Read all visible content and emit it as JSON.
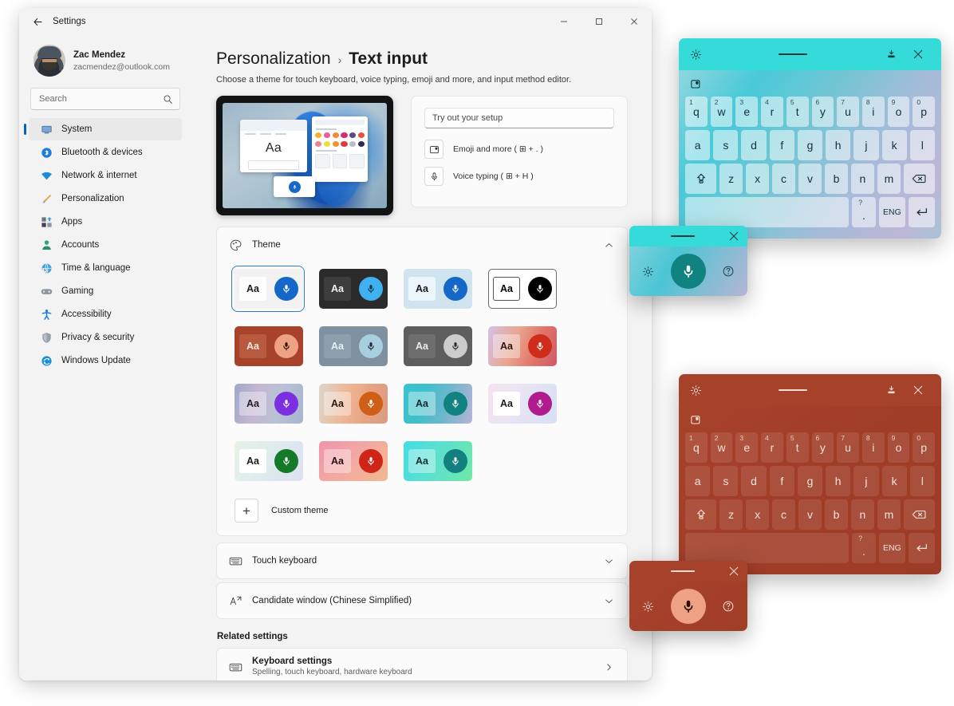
{
  "window": {
    "title": "Settings",
    "back_icon": "back-arrow-icon",
    "minimize": "−",
    "maximize": "▢",
    "close": "✕"
  },
  "account": {
    "name": "Zac Mendez",
    "email": "zacmendez@outlook.com",
    "avatar_icon": "user-avatar-photo"
  },
  "search": {
    "placeholder": "Search",
    "icon": "search-icon"
  },
  "sidebar": {
    "items": [
      {
        "label": "System",
        "icon": "monitor-icon",
        "active": true
      },
      {
        "label": "Bluetooth & devices",
        "icon": "bluetooth-icon",
        "active": false
      },
      {
        "label": "Network & internet",
        "icon": "wifi-icon",
        "active": false
      },
      {
        "label": "Personalization",
        "icon": "paintbrush-icon",
        "active": false
      },
      {
        "label": "Apps",
        "icon": "apps-icon",
        "active": false
      },
      {
        "label": "Accounts",
        "icon": "account-icon",
        "active": false
      },
      {
        "label": "Time & language",
        "icon": "clock-globe-icon",
        "active": false
      },
      {
        "label": "Gaming",
        "icon": "gamepad-icon",
        "active": false
      },
      {
        "label": "Accessibility",
        "icon": "accessibility-icon",
        "active": false
      },
      {
        "label": "Privacy & security",
        "icon": "shield-icon",
        "active": false
      },
      {
        "label": "Windows Update",
        "icon": "update-icon",
        "active": false
      }
    ]
  },
  "page": {
    "breadcrumb_parent": "Personalization",
    "breadcrumb_sep": "›",
    "breadcrumb_current": "Text input",
    "subtitle": "Choose a theme for touch keyboard, voice typing, emoji and more, and input method editor."
  },
  "tryout": {
    "input_placeholder": "Try out your setup",
    "rows": [
      {
        "label": "Emoji and more ( ⊞ + . )",
        "icon": "emoji-picker-icon"
      },
      {
        "label": "Voice typing ( ⊞ + H )",
        "icon": "microphone-icon"
      }
    ]
  },
  "theme_section": {
    "title": "Theme",
    "icon": "palette-icon",
    "chevron": "chevron-up-icon",
    "custom_theme_label": "Custom theme",
    "custom_theme_plus": "+",
    "swatches": [
      {
        "name": "light-default",
        "selected": true,
        "bg": "#f2f2f2",
        "box": "#fdfdfd",
        "aa": "#1b1b1b",
        "mic": "#1668c8",
        "mic_glyph": "#ffffff",
        "gradient": ""
      },
      {
        "name": "dark",
        "selected": false,
        "bg": "#2b2b2b",
        "box": "#3d3d3d",
        "aa": "#f0f0f0",
        "mic": "#3fb0f0",
        "mic_glyph": "#16364d",
        "gradient": ""
      },
      {
        "name": "powder-blue",
        "selected": false,
        "bg": "#cfe4ef",
        "box": "#ecf5fa",
        "aa": "#1b1b1b",
        "mic": "#1668c8",
        "mic_glyph": "#ffffff",
        "gradient": ""
      },
      {
        "name": "high-contrast-white",
        "selected": false,
        "bg": "#ffffff",
        "box": "#ffffff",
        "aa": "#000000",
        "mic": "#000000",
        "mic_glyph": "#ffffff",
        "gradient": ""
      },
      {
        "name": "brick-red",
        "selected": false,
        "bg": "#a8422a",
        "box": "#b85a40",
        "aa": "#f6e6e0",
        "mic": "#efa184",
        "mic_glyph": "#2b1008",
        "gradient": ""
      },
      {
        "name": "slate-blue",
        "selected": false,
        "bg": "#7e91a0",
        "box": "#8c9fad",
        "aa": "#e9eef2",
        "mic": "#a8cfe0",
        "mic_glyph": "#1b2a33",
        "gradient": ""
      },
      {
        "name": "graphite-gray",
        "selected": false,
        "bg": "#5e5e5e",
        "box": "#6e6e6e",
        "aa": "#ececec",
        "mic": "#cccccc",
        "mic_glyph": "#2b2b2b",
        "gradient": ""
      },
      {
        "name": "sunset-red",
        "selected": false,
        "bg": "#e2a08f",
        "box": "#f0c6b8",
        "aa": "#2a1410",
        "mic": "#cf2d1c",
        "mic_glyph": "#ffffff",
        "gradient": "linear-gradient(110deg,#d3c2e8 0%,#e9a58f 38%,#e2756a 68%,#cf5a6a 100%)"
      },
      {
        "name": "lavender-mist",
        "selected": false,
        "bg": "#b9aecb",
        "box": "#cfc7dd",
        "aa": "#24202b",
        "mic": "#7b2fe0",
        "mic_glyph": "#ffffff",
        "gradient": "linear-gradient(105deg,#9fa8c9 0%,#c4b6d2 32%,#b9c2d6 62%,#a8b4cf 100%)"
      },
      {
        "name": "peach-sand",
        "selected": false,
        "bg": "#e6b99a",
        "box": "#f2d7c4",
        "aa": "#2a1a10",
        "mic": "#cf5e16",
        "mic_glyph": "#ffffff",
        "gradient": "linear-gradient(100deg,#dcd6cc 0%,#efb594 40%,#e8a381 70%,#d99a85 100%)"
      },
      {
        "name": "teal-wave",
        "selected": false,
        "bg": "#3fc6d0",
        "box": "#7fd8e0",
        "aa": "#102a2e",
        "mic": "#10827f",
        "mic_glyph": "#ffffff",
        "gradient": "linear-gradient(105deg,#38c4cf 0%,#3ec0cb 30%,#6fb6cc 62%,#b6b4d8 100%)"
      },
      {
        "name": "orchid-white",
        "selected": false,
        "bg": "#dbe3f4",
        "box": "#ffffff",
        "aa": "#1b1b1b",
        "mic": "#b01b8e",
        "mic_glyph": "#ffffff",
        "gradient": "linear-gradient(110deg,#f4e4f0 0%,#e6e4f4 50%,#d6e0f6 100%)"
      },
      {
        "name": "mint-green",
        "selected": false,
        "bg": "#dff0e4",
        "box": "#ffffff",
        "aa": "#1b1b1b",
        "mic": "#137a28",
        "mic_glyph": "#ffffff",
        "gradient": "linear-gradient(115deg,#e4f4e6 0%,#dfeced 45%,#dde0f2 100%)"
      },
      {
        "name": "coral-pink",
        "selected": false,
        "bg": "#f09ca8",
        "box": "#f7c2bc",
        "aa": "#2a1012",
        "mic": "#cf2418",
        "mic_glyph": "#ffffff",
        "gradient": "linear-gradient(135deg,#ef93ad 0%,#f3a9a2 50%,#f2b98c 100%)"
      },
      {
        "name": "aqua-mint",
        "selected": false,
        "bg": "#5fe0c8",
        "box": "#a6f0de",
        "aa": "#10302a",
        "mic": "#12807e",
        "mic_glyph": "#ffffff",
        "gradient": "linear-gradient(115deg,#42dde4 0%,#5ce0cd 48%,#6fe8a8 100%)"
      }
    ]
  },
  "sections": [
    {
      "title": "Touch keyboard",
      "icon": "keyboard-icon",
      "chevron": "chevron-down-icon"
    },
    {
      "title": "Candidate window (Chinese Simplified)",
      "icon": "ime-icon",
      "chevron": "chevron-down-icon"
    }
  ],
  "related": {
    "heading": "Related settings",
    "item": {
      "title": "Keyboard settings",
      "subtitle": "Spelling, touch keyboard, hardware keyboard",
      "icon": "keyboard-icon",
      "chevron": "chevron-right-icon"
    }
  },
  "keyboards": [
    {
      "name": "teal-keyboard",
      "titlebar_bg": "#35dbd8",
      "titlebar_fg": "#0f3b3d",
      "body_gradient": "linear-gradient(125deg,#8fd7de 0%,#49c9d8 22%,#6fc6d4 42%,#a3bcd8 66%,#bdb6d6 88%,#a9c3d6 100%)",
      "key_bg": "rgba(255,255,255,0.52)",
      "key_fg": "#123238",
      "accent_bg": "rgba(255,255,255,0.30)",
      "gear_icon": "gear-icon",
      "dock_icon": "dock-icon",
      "close_icon": "close-icon",
      "sticker_icon": "sticker-heart-icon",
      "rows": [
        {
          "type": "num",
          "keys": [
            {
              "num": "1",
              "ch": "q"
            },
            {
              "num": "2",
              "ch": "w"
            },
            {
              "num": "3",
              "ch": "e"
            },
            {
              "num": "4",
              "ch": "r"
            },
            {
              "num": "5",
              "ch": "t"
            },
            {
              "num": "6",
              "ch": "y"
            },
            {
              "num": "7",
              "ch": "u"
            },
            {
              "num": "8",
              "ch": "i"
            },
            {
              "num": "9",
              "ch": "o"
            },
            {
              "num": "0",
              "ch": "p"
            }
          ]
        },
        {
          "type": "mid",
          "keys": [
            {
              "ch": "a"
            },
            {
              "ch": "s"
            },
            {
              "ch": "d"
            },
            {
              "ch": "f"
            },
            {
              "ch": "g"
            },
            {
              "ch": "h"
            },
            {
              "ch": "j"
            },
            {
              "ch": "k"
            },
            {
              "ch": "l"
            }
          ]
        },
        {
          "type": "bottom",
          "keys": [
            {
              "ch": "⇧",
              "icon": "shift-icon"
            },
            {
              "ch": "z"
            },
            {
              "ch": "x"
            },
            {
              "ch": "c"
            },
            {
              "ch": "v"
            },
            {
              "ch": "b"
            },
            {
              "ch": "n"
            },
            {
              "ch": "m"
            },
            {
              "ch": "⌫",
              "icon": "backspace-icon"
            }
          ]
        },
        {
          "type": "space",
          "keys": [
            {
              "ch": "",
              "icon": "space-key"
            },
            {
              "ch": ".",
              "alt": "?"
            },
            {
              "ch": "ENG"
            },
            {
              "ch": "↵",
              "icon": "enter-icon"
            }
          ]
        }
      ]
    },
    {
      "name": "red-keyboard",
      "titlebar_bg": "#a6412a",
      "titlebar_fg": "#f7ddd4",
      "body_gradient": "linear-gradient(140deg,#a8422b 0%,#a03d27 50%,#9d3c26 100%)",
      "key_bg": "rgba(255,255,255,0.10)",
      "key_fg": "#f6e2da",
      "accent_bg": "rgba(255,255,255,0.07)",
      "gear_icon": "gear-icon",
      "dock_icon": "dock-icon",
      "close_icon": "close-icon",
      "sticker_icon": "sticker-heart-icon",
      "rows": [
        {
          "type": "num",
          "keys": [
            {
              "num": "1",
              "ch": "q"
            },
            {
              "num": "2",
              "ch": "w"
            },
            {
              "num": "3",
              "ch": "e"
            },
            {
              "num": "4",
              "ch": "r"
            },
            {
              "num": "5",
              "ch": "t"
            },
            {
              "num": "6",
              "ch": "y"
            },
            {
              "num": "7",
              "ch": "u"
            },
            {
              "num": "8",
              "ch": "i"
            },
            {
              "num": "9",
              "ch": "o"
            },
            {
              "num": "0",
              "ch": "p"
            }
          ]
        },
        {
          "type": "mid",
          "keys": [
            {
              "ch": "a"
            },
            {
              "ch": "s"
            },
            {
              "ch": "d"
            },
            {
              "ch": "f"
            },
            {
              "ch": "g"
            },
            {
              "ch": "h"
            },
            {
              "ch": "j"
            },
            {
              "ch": "k"
            },
            {
              "ch": "l"
            }
          ]
        },
        {
          "type": "bottom",
          "keys": [
            {
              "ch": "⇧",
              "icon": "shift-icon"
            },
            {
              "ch": "z"
            },
            {
              "ch": "x"
            },
            {
              "ch": "c"
            },
            {
              "ch": "v"
            },
            {
              "ch": "b"
            },
            {
              "ch": "n"
            },
            {
              "ch": "m"
            },
            {
              "ch": "⌫",
              "icon": "backspace-icon"
            }
          ]
        },
        {
          "type": "space",
          "keys": [
            {
              "ch": "",
              "icon": "space-key"
            },
            {
              "ch": ".",
              "alt": "?"
            },
            {
              "ch": "ENG"
            },
            {
              "ch": "↵",
              "icon": "enter-icon"
            }
          ]
        }
      ]
    }
  ],
  "voice_popups": [
    {
      "name": "teal-voice-typing",
      "titlebar_bg": "#35dbd8",
      "titlebar_fg": "#0f3b3d",
      "body_gradient": "linear-gradient(120deg,#7fd2dc 0%,#4cc5d4 35%,#86bcd4 70%,#b4b6d4 100%)",
      "mic_bg": "#10827f",
      "mic_fg": "#ffffff",
      "icon_fg": "#13494d",
      "gear_icon": "gear-icon",
      "mic_icon": "microphone-icon",
      "help_icon": "help-icon",
      "close_icon": "close-icon"
    },
    {
      "name": "red-voice-typing",
      "titlebar_bg": "#a6412a",
      "titlebar_fg": "#f7ddd4",
      "body_gradient": "linear-gradient(140deg,#a8422b 0%,#a03d27 100%)",
      "mic_bg": "#efa184",
      "mic_fg": "#2b1008",
      "icon_fg": "#f6ddd4",
      "gear_icon": "gear-icon",
      "mic_icon": "microphone-icon",
      "help_icon": "help-icon",
      "close_icon": "close-icon"
    }
  ]
}
